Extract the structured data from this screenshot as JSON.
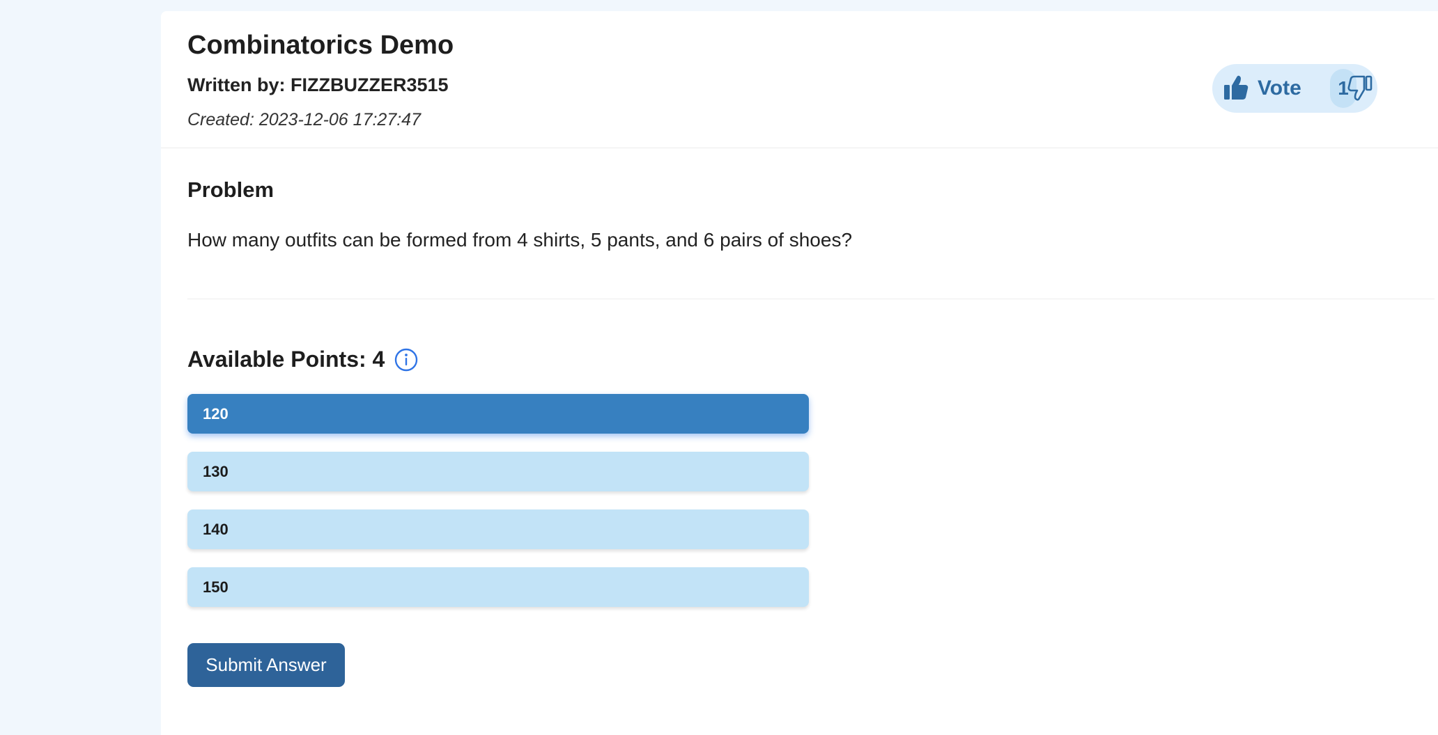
{
  "header": {
    "title": "Combinatorics Demo",
    "author": "Written by: FIZZBUZZER3515",
    "created": "Created: 2023-12-06 17:27:47"
  },
  "vote": {
    "label": "Vote",
    "count": "1",
    "up_icon": "thumbs-up-icon",
    "down_icon": "thumbs-down-icon"
  },
  "problem": {
    "heading": "Problem",
    "text": "How many outfits can be formed from 4 shirts, 5 pants, and 6 pairs of shoes?"
  },
  "points": {
    "label": "Available Points: 4",
    "icon": "info-icon"
  },
  "options": [
    {
      "label": "120",
      "selected": true
    },
    {
      "label": "130",
      "selected": false
    },
    {
      "label": "140",
      "selected": false
    },
    {
      "label": "150",
      "selected": false
    }
  ],
  "submit": {
    "label": "Submit Answer"
  },
  "colors": {
    "accent": "#3780c0",
    "option_bg": "#c2e3f7",
    "submit_bg": "#2e6399",
    "vote_text": "#2d6aa1",
    "page_bg": "#f1f7fd"
  }
}
